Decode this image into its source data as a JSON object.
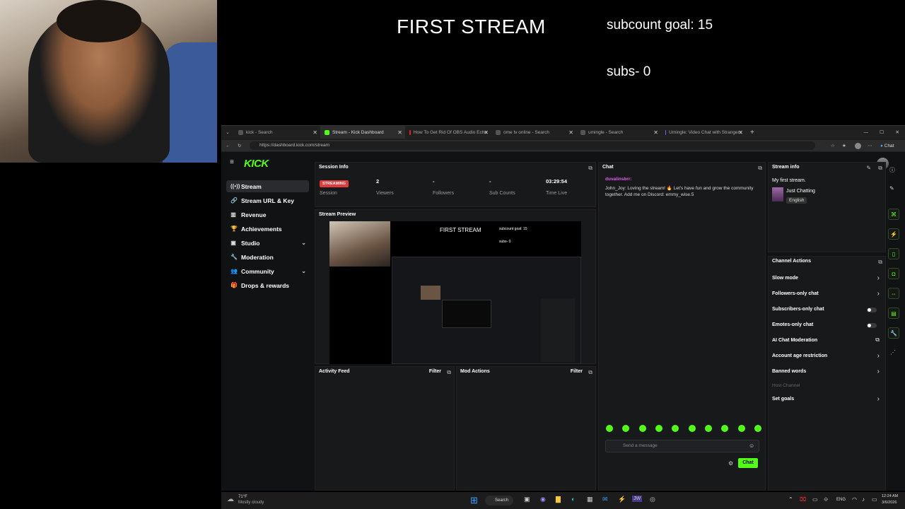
{
  "overlay": {
    "title": "FIRST STREAM",
    "subcount_goal": "subcount goal: 15",
    "subs": "subs- 0"
  },
  "browser": {
    "tabs": [
      {
        "label": "kick - Search",
        "icon": "search-icon",
        "active": false
      },
      {
        "label": "Stream - Kick Dashboard",
        "icon": "kick-icon",
        "active": true
      },
      {
        "label": "How To Get Rid Of OBS Audio Echo",
        "icon": "youtube-icon",
        "active": false
      },
      {
        "label": "ome tv online - Search",
        "icon": "search-icon",
        "active": false
      },
      {
        "label": "umingle - Search",
        "icon": "search-icon",
        "active": false
      },
      {
        "label": "Umingle: Video Chat with Strangers",
        "icon": "umingle-icon",
        "active": false
      }
    ],
    "url": "https://dashboard.kick.com/stream",
    "chat_button": "Chat"
  },
  "kick": {
    "logo": "KICK",
    "sidebar": [
      {
        "label": "Stream",
        "icon": "broadcast-icon",
        "active": true,
        "expandable": false
      },
      {
        "label": "Stream URL & Key",
        "icon": "link-icon",
        "active": false,
        "expandable": false
      },
      {
        "label": "Revenue",
        "icon": "revenue-icon",
        "active": false,
        "expandable": false
      },
      {
        "label": "Achievements",
        "icon": "trophy-icon",
        "active": false,
        "expandable": false
      },
      {
        "label": "Studio",
        "icon": "studio-icon",
        "active": false,
        "expandable": true
      },
      {
        "label": "Moderation",
        "icon": "wrench-icon",
        "active": false,
        "expandable": false
      },
      {
        "label": "Community",
        "icon": "people-icon",
        "active": false,
        "expandable": true
      },
      {
        "label": "Drops & rewards",
        "icon": "gift-icon",
        "active": false,
        "expandable": false
      }
    ],
    "session": {
      "title": "Session Info",
      "status": "STREAMING",
      "status_label": "Session",
      "viewers": "2",
      "viewers_label": "Viewers",
      "followers": "-",
      "followers_label": "Followers",
      "subs": "-",
      "subs_label": "Sub Counts",
      "time": "03:29:54",
      "time_label": "Time Live"
    },
    "preview": {
      "title": "Stream Preview",
      "overlay_title": "FIRST STREAM",
      "overlay_goal": "subcount goal: 15",
      "overlay_subs": "subs- 0"
    },
    "activity": {
      "title": "Activity Feed",
      "filter": "Filter"
    },
    "mod": {
      "title": "Mod Actions",
      "filter": "Filter"
    },
    "chat": {
      "title": "Chat",
      "user": "duvalinsbrr:",
      "message": "John_Joy: Loving the stream! 🔥 Let's have fun and grow the community together. Add me on Discord: emmy_wise.5",
      "placeholder": "Send a message",
      "send": "Chat"
    },
    "stream_info": {
      "title": "Stream info",
      "stream_title": "My first stream.",
      "category": "Just Chatting",
      "language": "English"
    },
    "channel_actions": {
      "title": "Channel Actions",
      "items": [
        {
          "label": "Slow mode",
          "control": "chevron"
        },
        {
          "label": "Followers-only chat",
          "control": "chevron"
        },
        {
          "label": "Subscribers-only chat",
          "control": "toggle"
        },
        {
          "label": "Emotes-only chat",
          "control": "toggle"
        },
        {
          "label": "AI Chat Moderation",
          "control": "external"
        },
        {
          "label": "Account age restriction",
          "control": "chevron"
        },
        {
          "label": "Banned words",
          "control": "chevron"
        },
        {
          "label": "Host Channel",
          "control": "none"
        },
        {
          "label": "Set goals",
          "control": "chevron"
        }
      ]
    }
  },
  "taskbar": {
    "weather_temp": "71°F",
    "weather_desc": "Mostly cloudy",
    "search": "Search",
    "lang": "ENG",
    "time": "12:24 AM",
    "date": "3/6/2026"
  },
  "colors": {
    "kick_green": "#53fc18",
    "live_red": "#e03a3a",
    "bg": "#111214"
  }
}
